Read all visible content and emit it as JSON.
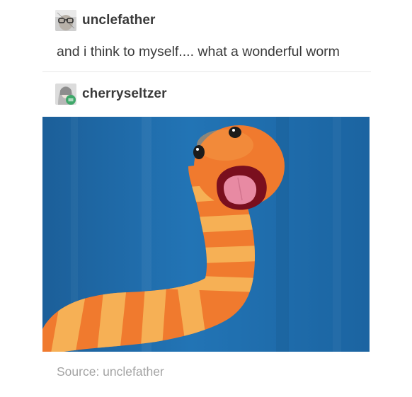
{
  "post": {
    "author": "unclefather",
    "text": "and i think to myself.... what a wonderful worm"
  },
  "reblog": {
    "author": "cherryseltzer",
    "image_description_icon": "worm-puppet-photo",
    "source_label": "Source: unclefather"
  },
  "colors": {
    "background": "#ffffff",
    "text": "#3a3a3a",
    "muted_text": "#a3a3a3",
    "divider": "#e6e6e6",
    "photo_backdrop": "#1f6fae",
    "worm_orange": "#f07a2e",
    "worm_stripe": "#f6b055"
  }
}
